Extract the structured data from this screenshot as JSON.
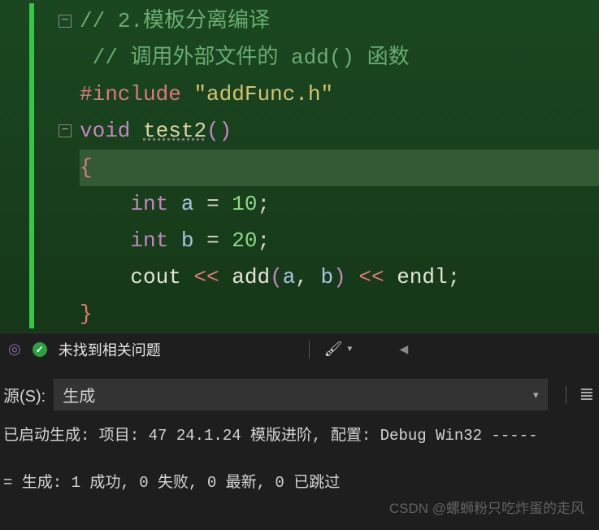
{
  "code": {
    "line1_comment": "// 2.模板分离编译",
    "line2_comment": "// 调用外部文件的 add() 函数",
    "include_directive": "#include",
    "include_file": "\"addFunc.h\"",
    "void_kw": "void",
    "test2_name": "test2",
    "open_brace": "{",
    "int_kw_a": "int",
    "var_a": "a",
    "assign": "=",
    "val_10": "10",
    "int_kw_b": "int",
    "var_b": "b",
    "val_20": "20",
    "cout": "cout",
    "ltlt": "<<",
    "add_call": "add",
    "arg_a": "a",
    "comma": ",",
    "arg_b": "b",
    "endl": "endl",
    "semi": ";",
    "close_brace": "}"
  },
  "status": {
    "no_issues": "未找到相关问题"
  },
  "output": {
    "source_label": "源(S):",
    "source_value": "生成",
    "line1": "已启动生成: 项目: 47 24.1.24 模版进阶, 配置: Debug Win32 -----",
    "line2": "= 生成: 1 成功, 0 失败, 0 最新, 0 已跳过"
  },
  "watermark": "CSDN @螺蛳粉只吃炸蛋的走风"
}
